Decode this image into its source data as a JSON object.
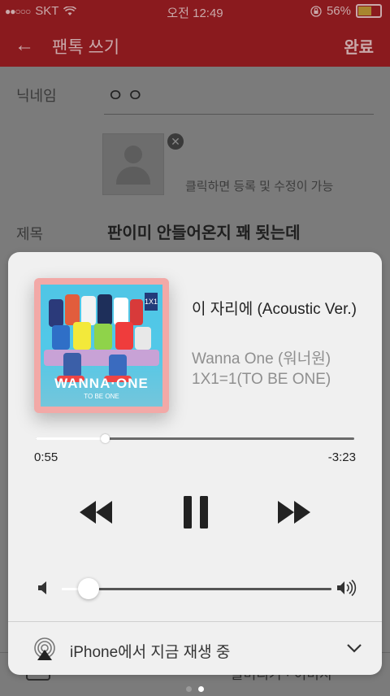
{
  "status_bar": {
    "signal": "●●○○○",
    "carrier": "SKT",
    "time": "오전 12:49",
    "battery": "56%"
  },
  "header": {
    "back_icon": "←",
    "title": "팬톡 쓰기",
    "done_label": "완료"
  },
  "form": {
    "nickname_label": "닉네임",
    "nickname_value": "ㅇㅇ",
    "photo_hint": "클릭하면 등록 및 수정이 가능",
    "title_label": "제목",
    "title_value": "판이미 안들어온지 꽤 됫는데",
    "bottom_text": "글머리기 · 이미지"
  },
  "album": {
    "title": "WANNA·ONE",
    "subtitle": "TO BE ONE",
    "badge": "1X1"
  },
  "now_playing": {
    "song_title": "이 자리에 (Acoustic Ver.)",
    "artist": "Wanna One (워너원)",
    "album_name": "1X1=1(TO BE ONE)",
    "elapsed": "0:55",
    "remaining": "-3:23",
    "progress": 0.217,
    "volume": 0.1
  },
  "airplay": {
    "label": "iPhone에서 지금 재생 중"
  },
  "page_indicator": {
    "count": 2,
    "active": 1
  },
  "colors": {
    "header_dimmed": "#8a1a1e",
    "panel_bg": "#f0f0f0",
    "album_border": "#f2a9a7"
  }
}
